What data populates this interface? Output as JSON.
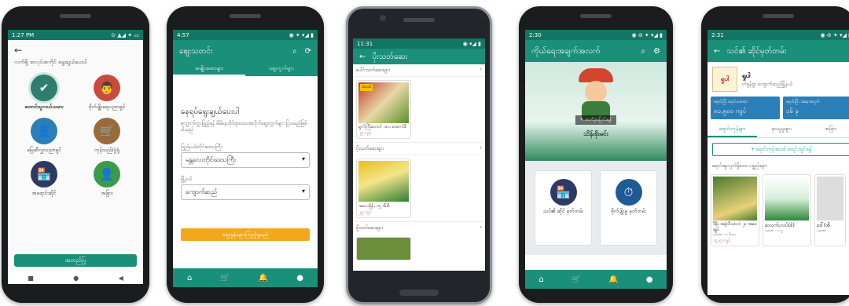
{
  "phone1": {
    "status_time": "1:27 PM",
    "status_icons": "⊙ ▲◢ ✦ ▭",
    "back": "←",
    "header": "လက်ရှိ အလုပ်အကိုင် ရွေးချယ်ပေးပါ",
    "roles": [
      {
        "label": "တောင်သူလယ်သမား",
        "icon": "✔",
        "color": "#2e7d6f"
      },
      {
        "label": "စိုက်ပျိုးရေးပညာရှင်",
        "icon": "👨",
        "color": "#c94b3f"
      },
      {
        "label": "မြေဆီလွှာပညာရှင်",
        "icon": "👤",
        "color": "#2a7fb8"
      },
      {
        "label": "ကုန်သည်/ပွဲရုံ",
        "icon": "🛒",
        "color": "#9a6b3a"
      },
      {
        "label": "အရောင်းဆိုင်",
        "icon": "🏪",
        "color": "#2b3a66"
      },
      {
        "label": "အခြား",
        "icon": "👤",
        "color": "#3a9c4a"
      }
    ],
    "confirm_button": "အတည်ပြု",
    "nav": [
      "■",
      "●",
      "◀"
    ]
  },
  "phone2": {
    "status_time": "4:57",
    "status_icons": "◉ ✦ ▾◢ ▮",
    "title": "ဈေးသတင်း",
    "tabs": [
      "အမျိုးအစားများ",
      "ဈေးကွက်များ"
    ],
    "heading": "နေရပ်ရွေးချယ်ပေးပါ",
    "subtext": "လျှောက်လွှာဖြည့်ရန် မိမိနေထိုင်ရာဒေသအလိုက်ဈေးကွက်များ ပြသမည်ဖြစ်ပါသည်",
    "field1_label": "ပြည်နယ်/တိုင်းဒေသကြီး",
    "field1_value": "မန္တလေးတိုင်းဒေသကြီး",
    "field2_label": "မြို့နယ်",
    "field2_value": "ကျောက်ဆည်",
    "submit": "ဈေးနှုန်းများကြည့်ရှုမည်",
    "nav": [
      "⌂",
      "🛒",
      "🔔",
      "●"
    ]
  },
  "phone3": {
    "status_time": "11:31",
    "status_icons": "◉ ▾◢ ▮",
    "title": "ပိုးသတ်ဆေး",
    "sections": [
      {
        "label": "ပေါင်းသတ်ဆေးများ",
        "product_name": "ရွက်ကြီးတောင် ၁၈၁ အောက်စီ",
        "price": "၂၅ ကျပ်",
        "color": "#c0392b"
      },
      {
        "label": "ပိုးသတ်ဆေးများ",
        "product_name": "အလေရှိန်း ၁၅ အီးစီ",
        "price": "၂၅ ကျပ်",
        "color": "#e6c020"
      },
      {
        "label": "မှိုသတ်ဆေးများ",
        "product_name": "",
        "price": "",
        "color": "#6b8f3a"
      }
    ],
    "badge": "အသစ်"
  },
  "phone4": {
    "status_time": "2:30",
    "status_icons": "◉ ⊘ ✦ ▾◢ ▮",
    "title": "ကိုယ်ရေးအချက်အလက်",
    "photo_label": "ဓာတ်ပုံပြောင်းရန်",
    "name": "သိန်းစိုးမင်း",
    "tiles": [
      {
        "label": "သင်၏ ဆိုင် မှတ်တမ်း",
        "icon": "🏪",
        "color": "#2b3a66"
      },
      {
        "label": "စိုက်ပျိုးမှု မှတ်တမ်း",
        "icon": "⏱",
        "color": "#1d5a96"
      }
    ],
    "nav": [
      "⌂",
      "🛒",
      "🔔",
      "●"
    ]
  },
  "phone5": {
    "status_time": "2:31",
    "status_icons": "◉ ⊘ ✦ ▾◢ ▮",
    "title": "သင်၏ ဆိုင်မှတ်တမ်း",
    "shop_logo": "ရှုပါ",
    "shop_name": "ရှုပါ",
    "shop_address": "တံခွန်ရွာ ကျောက်ဆည်မြို့နယ်",
    "stat1_label": "ရောင်းပြီး ရောင်းပမာဏ",
    "stat1_value": "၈၁,၅၀၀ ကျပ်",
    "stat2_label": "ရောင်းပြီး အရေအတွက်",
    "stat2_value": "၁၆ ခု",
    "tabs": [
      "ရောင်းကုန်များ",
      "မှာယူမှုများ",
      "အခြား"
    ],
    "add_button": "+ ရောင်းကုန်အသစ် စာရင်းသွင်းရန်",
    "list_header": "ရောင်းချလျက်ရှိသော ပစ္စည်းများ",
    "products": [
      {
        "name": "ဒီစိုး အနံ့တီသာကဲ ၂၀ အစေချုပ်",
        "sub": "ပမာဏ - ၁ ပိဿ",
        "price": "၁၄,၅ ကျပ်",
        "color": "#4a7a2e"
      },
      {
        "name": "ဆလက်ပလပ်(စ်)",
        "sub": "ပမာဏ - ၁ ဂူ",
        "price": "",
        "color": "#2e8a3a"
      },
      {
        "name": "ဒေါ်(အိ",
        "sub": "ပမာဏ",
        "price": "",
        "color": "#777777"
      }
    ]
  }
}
